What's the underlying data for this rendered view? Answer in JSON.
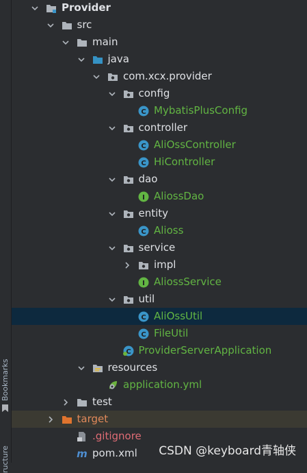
{
  "sidebar": {
    "bookmarks_label": "Bookmarks",
    "structure_label": "ructure"
  },
  "tree": [
    {
      "label": "Provider",
      "icon": "module-folder-icon",
      "state": "expanded",
      "color": "white",
      "bold": true
    },
    {
      "label": "src",
      "icon": "folder-icon",
      "state": "expanded",
      "color": "white"
    },
    {
      "label": "main",
      "icon": "folder-icon",
      "state": "expanded",
      "color": "white"
    },
    {
      "label": "java",
      "icon": "source-folder-icon",
      "state": "expanded",
      "color": "white"
    },
    {
      "label": "com.xcx.provider",
      "icon": "package-icon",
      "state": "expanded",
      "color": "white"
    },
    {
      "label": "config",
      "icon": "package-icon",
      "state": "expanded",
      "color": "white"
    },
    {
      "label": "MybatisPlusConfig",
      "icon": "class-icon",
      "state": "leaf",
      "color": "green"
    },
    {
      "label": "controller",
      "icon": "package-icon",
      "state": "expanded",
      "color": "white"
    },
    {
      "label": "AliOssController",
      "icon": "class-icon",
      "state": "leaf",
      "color": "green"
    },
    {
      "label": "HiController",
      "icon": "class-icon",
      "state": "leaf",
      "color": "green"
    },
    {
      "label": "dao",
      "icon": "package-icon",
      "state": "expanded",
      "color": "white"
    },
    {
      "label": "AliossDao",
      "icon": "interface-icon",
      "state": "leaf",
      "color": "green"
    },
    {
      "label": "entity",
      "icon": "package-icon",
      "state": "expanded",
      "color": "white"
    },
    {
      "label": "Alioss",
      "icon": "class-icon",
      "state": "leaf",
      "color": "green"
    },
    {
      "label": "service",
      "icon": "package-icon",
      "state": "expanded",
      "color": "white"
    },
    {
      "label": "impl",
      "icon": "package-icon",
      "state": "collapsed",
      "color": "white"
    },
    {
      "label": "AliossService",
      "icon": "interface-icon",
      "state": "leaf",
      "color": "green"
    },
    {
      "label": "util",
      "icon": "package-icon",
      "state": "expanded",
      "color": "white"
    },
    {
      "label": "AliOssUtil",
      "icon": "class-icon",
      "state": "leaf",
      "color": "green",
      "selected": true
    },
    {
      "label": "FileUtil",
      "icon": "class-icon",
      "state": "leaf",
      "color": "green"
    },
    {
      "label": "ProviderServerApplication",
      "icon": "spring-class-icon",
      "state": "leaf",
      "color": "green"
    },
    {
      "label": "resources",
      "icon": "resources-folder-icon",
      "state": "expanded",
      "color": "white"
    },
    {
      "label": "application.yml",
      "icon": "spring-yml-icon",
      "state": "leaf",
      "color": "green"
    },
    {
      "label": "test",
      "icon": "folder-icon",
      "state": "collapsed",
      "color": "white"
    },
    {
      "label": "target",
      "icon": "excluded-folder-icon",
      "state": "collapsed",
      "color": "orange",
      "highlight": true
    },
    {
      "label": ".gitignore",
      "icon": "gitignore-file-icon",
      "state": "leaf",
      "color": "red"
    },
    {
      "label": "pom.xml",
      "icon": "maven-icon",
      "state": "leaf",
      "color": "white"
    }
  ],
  "watermark": "CSDN @keyboard青轴侠",
  "colors": {
    "background": "#2b2d30",
    "selection": "#0d293e",
    "excluded_highlight": "#3b3a32",
    "text": "#dfe1e5",
    "green": "#62b543",
    "orange": "#e0895a",
    "red": "#e06c75",
    "class_icon": "#3a95c8",
    "interface_icon": "#62b543"
  }
}
